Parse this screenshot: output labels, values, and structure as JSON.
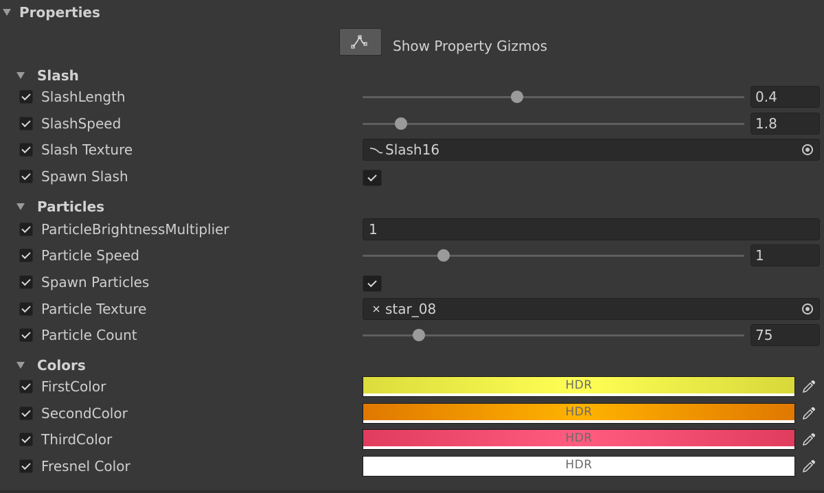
{
  "header": {
    "title": "Properties"
  },
  "gizmo": {
    "label": "Show Property Gizmos"
  },
  "sections": {
    "slash": {
      "title": "Slash"
    },
    "particles": {
      "title": "Particles"
    },
    "colors": {
      "title": "Colors"
    }
  },
  "slash": {
    "length": {
      "label": "SlashLength",
      "value": "0.4",
      "fraction": 0.405
    },
    "speed": {
      "label": "SlashSpeed",
      "value": "1.8",
      "fraction": 0.101
    },
    "texture": {
      "label": "Slash Texture",
      "object": "Slash16"
    },
    "spawn": {
      "label": "Spawn Slash",
      "checked": true
    }
  },
  "particles": {
    "brightness": {
      "label": "ParticleBrightnessMultiplier",
      "value": "1"
    },
    "speed": {
      "label": "Particle Speed",
      "value": "1",
      "fraction": 0.213
    },
    "spawn": {
      "label": "Spawn Particles",
      "checked": true
    },
    "texture": {
      "label": "Particle Texture",
      "object": "star_08"
    },
    "count": {
      "label": "Particle Count",
      "value": "75",
      "fraction": 0.148
    }
  },
  "colors": {
    "first": {
      "label": "FirstColor",
      "hdr": "HDR",
      "color_left": "#dcdc3c",
      "color_mid": "#ffff55",
      "color_right": "#d8d83a"
    },
    "second": {
      "label": "SecondColor",
      "hdr": "HDR",
      "color_left": "#e07800",
      "color_mid": "#ffb300",
      "color_right": "#e07800"
    },
    "third": {
      "label": "ThirdColor",
      "hdr": "HDR",
      "color_left": "#e03c5e",
      "color_mid": "#ff5c80",
      "color_right": "#e03c5e"
    },
    "fresnel": {
      "label": "Fresnel Color",
      "hdr": "HDR",
      "color_left": "#ffffff",
      "color_mid": "#ffffff",
      "color_right": "#ffffff"
    }
  }
}
